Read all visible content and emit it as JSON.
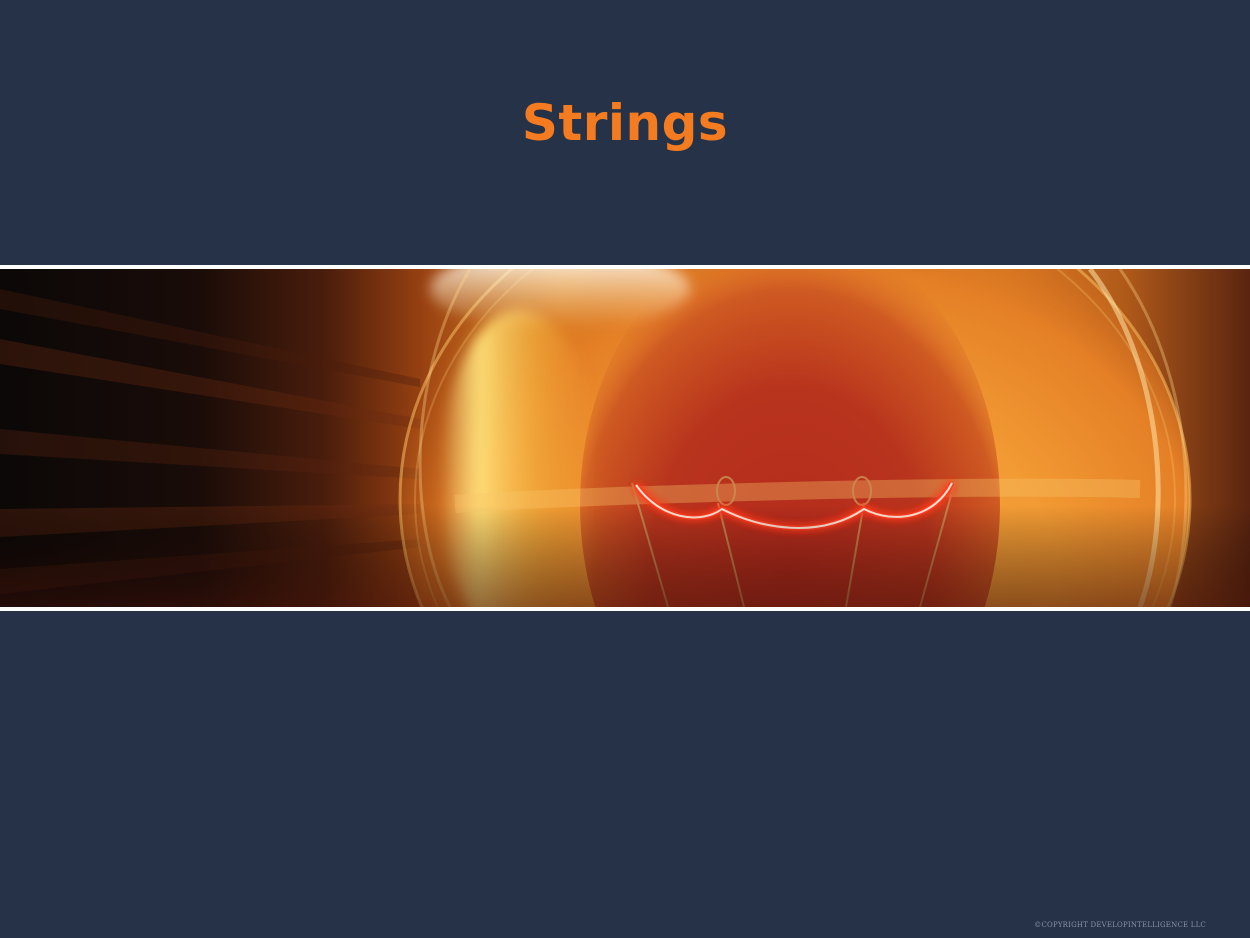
{
  "slide": {
    "title": "Strings",
    "footer": "©COPYRIGHT DEVELOPINTELLIGENCE LLC"
  },
  "colors": {
    "background": "#253247",
    "title": "#f47b20",
    "banner_border": "#ffffff",
    "footer": "#8b93a3",
    "filament_glow": "#ff3a22"
  },
  "banner": {
    "icon": "light-bulb-filament-image"
  }
}
